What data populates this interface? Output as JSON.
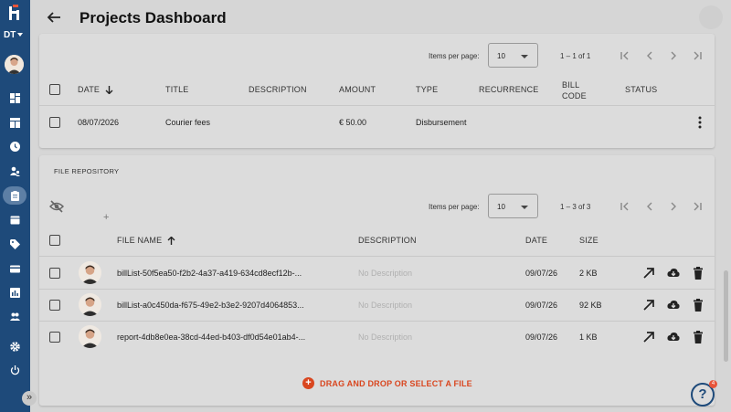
{
  "sidebar": {
    "workspace": "DT",
    "nav_icons": [
      "dashboard-icon",
      "table-icon",
      "clock-icon",
      "users-icon",
      "clipboard-icon",
      "calendar-icon",
      "tag-icon",
      "card-icon",
      "chart-icon",
      "people-icon",
      "gear-icon",
      "power-icon"
    ],
    "active": "clipboard-icon",
    "expand_label": "»",
    "brand_color": "#1e4a7a"
  },
  "header": {
    "title": "Projects Dashboard",
    "back_icon": "arrow-left-icon"
  },
  "bills": {
    "items_per_page_label": "Items per page:",
    "items_per_page": "10",
    "range": "1 – 1 of 1",
    "columns": [
      "DATE",
      "TITLE",
      "DESCRIPTION",
      "AMOUNT",
      "TYPE",
      "RECURRENCE",
      "BILL CODE",
      "STATUS"
    ],
    "bill_code_line1": "BILL",
    "bill_code_line2": "CODE",
    "rows": [
      {
        "date": "08/07/2026",
        "title": "Courier fees",
        "description": "",
        "amount": "€ 50.00",
        "type": "Disbursement",
        "recurrence": "",
        "bill_code": "",
        "status": ""
      }
    ]
  },
  "files": {
    "section_title": "FILE REPOSITORY",
    "items_per_page_label": "Items per page:",
    "items_per_page": "10",
    "range": "1 – 3 of 3",
    "columns": {
      "file_name": "FILE NAME",
      "description": "DESCRIPTION",
      "date": "DATE",
      "size": "SIZE"
    },
    "add_symbol": "+",
    "rows": [
      {
        "file_name": "billList-50f5ea50-f2b2-4a37-a419-634cd8ecf12b-...",
        "description": "No Description",
        "date": "09/07/26",
        "size": "2 KB"
      },
      {
        "file_name": "billList-a0c450da-f675-49e2-b3e2-9207d4064853...",
        "description": "No Description",
        "date": "09/07/26",
        "size": "92 KB"
      },
      {
        "file_name": "report-4db8e0ea-38cd-44ed-b403-df0d54e01ab4-...",
        "description": "No Description",
        "date": "09/07/26",
        "size": "1 KB"
      }
    ],
    "drop_label": "DRAG AND DROP OR SELECT A FILE",
    "drop_symbol": "+",
    "accent": "#d9461f"
  },
  "help": {
    "label": "?",
    "badge": "4"
  }
}
